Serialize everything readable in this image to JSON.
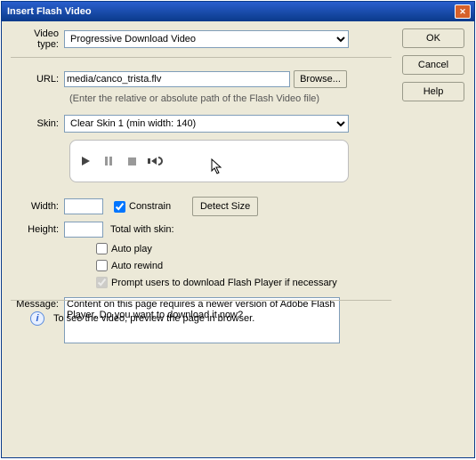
{
  "window": {
    "title": "Insert Flash Video"
  },
  "side": {
    "ok": "OK",
    "cancel": "Cancel",
    "help": "Help"
  },
  "videoType": {
    "label": "Video type:",
    "value": "Progressive Download Video"
  },
  "url": {
    "label": "URL:",
    "value": "media/canco_trista.flv",
    "browse": "Browse...",
    "hint": "(Enter the relative or absolute path of the Flash Video file)"
  },
  "skin": {
    "label": "Skin:",
    "value": "Clear Skin 1 (min width: 140)"
  },
  "width": {
    "label": "Width:",
    "value": "",
    "constrain": "Constrain",
    "detect": "Detect Size"
  },
  "height": {
    "label": "Height:",
    "value": "",
    "total": "Total with skin:"
  },
  "autoplay": "Auto play",
  "autorewind": "Auto rewind",
  "prompt": "Prompt users to download Flash Player if necessary",
  "message": {
    "label": "Message:",
    "value": "Content on this page requires a newer version of Adobe Flash Player. Do you want to download it now?"
  },
  "info": "To see the video, preview the page in browser."
}
